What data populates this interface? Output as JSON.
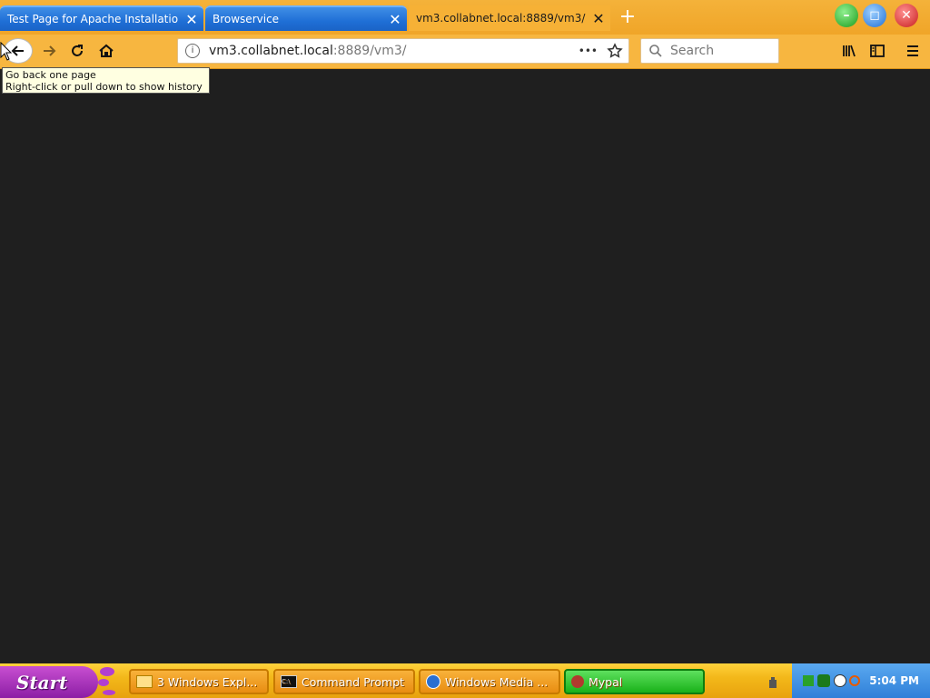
{
  "browser": {
    "tabs": [
      {
        "label": "Test Page for Apache Installatio",
        "close": "✕",
        "active": false
      },
      {
        "label": "Browservice",
        "close": "✕",
        "active": false
      },
      {
        "label": "vm3.collabnet.local:8889/vm3/",
        "close": "✕",
        "active": true
      }
    ],
    "new_tab": "+",
    "url": {
      "host": "vm3.collabnet.local",
      "rest": ":8889/vm3/"
    },
    "page_actions": "•••",
    "search_placeholder": "Search",
    "tooltip": {
      "line1": "Go back one page",
      "line2": "Right-click or pull down to show history"
    }
  },
  "taskbar": {
    "start_label": "Start",
    "buttons": [
      {
        "label": "3 Windows Expl...",
        "icon": "folder-icon"
      },
      {
        "label": "Command Prompt",
        "icon": "console-icon"
      },
      {
        "label": "Windows Media ...",
        "icon": "media-player-icon"
      },
      {
        "label": "Mypal",
        "icon": "browser-icon",
        "active": true
      }
    ],
    "clock": "5:04 PM"
  },
  "colors": {
    "accent": "#f7b640",
    "page_bg": "#1f1f1f",
    "taskbar_active": "#19b119"
  }
}
